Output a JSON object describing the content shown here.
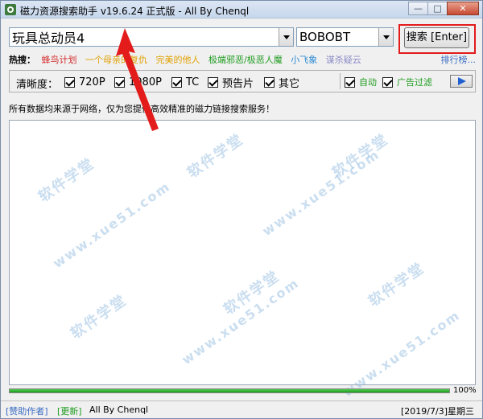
{
  "window": {
    "title": "磁力资源搜索助手 v19.6.24 正式版 - All By Chenql"
  },
  "window_buttons": {
    "minimize": "—",
    "maximize": "□",
    "close": "✕"
  },
  "search": {
    "query": "玩具总动员4",
    "source": "BOBOBT",
    "button_label": "搜索 [Enter]"
  },
  "hot": {
    "label": "热搜：",
    "items": [
      {
        "text": "蜂鸟计划",
        "color": "#d42a2a"
      },
      {
        "text": "一个母亲的复仇",
        "color": "#e0a000"
      },
      {
        "text": "完美的他人",
        "color": "#e0a000"
      },
      {
        "text": "极端邪恶/极恶人魔",
        "color": "#1f9c1f"
      },
      {
        "text": "小飞象",
        "color": "#2b8bd4"
      },
      {
        "text": "谋杀疑云",
        "color": "#8c8cc8"
      }
    ],
    "rank_link": "排行榜..."
  },
  "filters": {
    "label": "清晰度：",
    "options": [
      "720P",
      "1080P",
      "TC",
      "预告片",
      "其它"
    ],
    "auto": "自动",
    "ad_filter": "广告过滤"
  },
  "notice": "所有数据均来源于网络，仅为您提供高效精准的磁力链接搜索服务！",
  "watermark": "软件学堂",
  "watermark_url": "www.xue51.com",
  "progress": {
    "percent": 100,
    "label": "100%"
  },
  "status": {
    "help": "[赞助作者]",
    "update": "[更新]",
    "author": "All By Chenql",
    "date": "[2019/7/3]星期三"
  }
}
